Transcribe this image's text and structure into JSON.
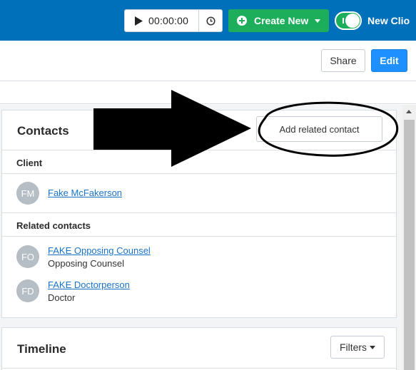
{
  "topbar": {
    "timer_value": "00:00:00",
    "play_icon": "play-icon",
    "clock_icon": "clock-icon",
    "create_new_label": "Create New",
    "new_clio_label": "New Clio",
    "colors": {
      "bar": "#0070bb",
      "create": "#1dae5b"
    }
  },
  "actionbar": {
    "share_label": "Share",
    "edit_label": "Edit"
  },
  "contacts": {
    "title": "Contacts",
    "add_related_label": "Add related contact",
    "client_section_label": "Client",
    "client": {
      "initials": "FM",
      "name": "Fake McFakerson"
    },
    "related_section_label": "Related contacts",
    "related": [
      {
        "initials": "FO",
        "name": "FAKE Opposing Counsel",
        "role": "Opposing Counsel"
      },
      {
        "initials": "FD",
        "name": "FAKE Doctorperson",
        "role": "Doctor"
      }
    ]
  },
  "timeline": {
    "title": "Timeline",
    "filters_label": "Filters"
  }
}
